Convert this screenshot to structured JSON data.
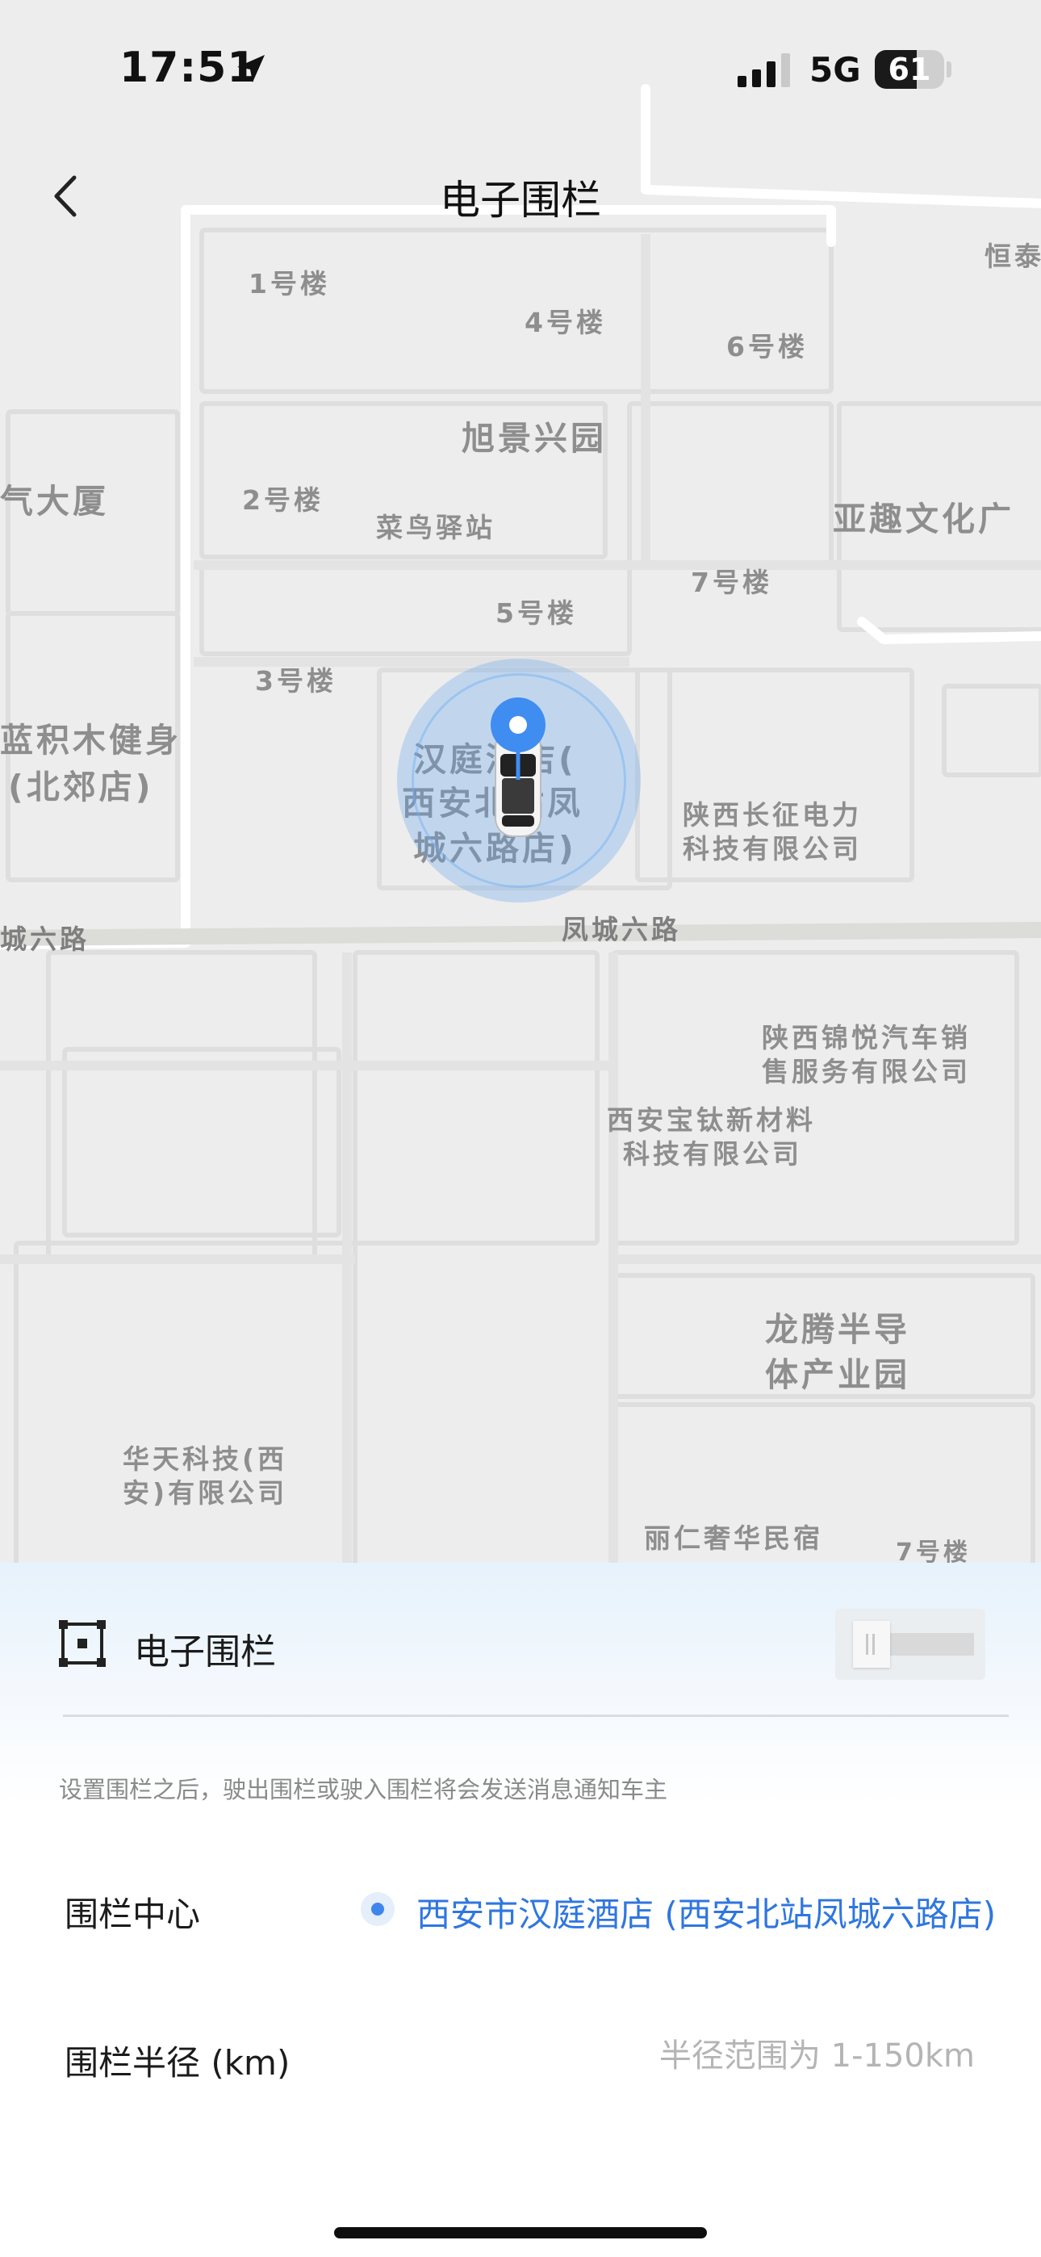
{
  "status_bar": {
    "time": "17:51",
    "network": "5G",
    "battery_level": "61",
    "battery_fraction": 0.61,
    "location_icon": "location-arrow-icon",
    "signal_icon": "cellular-signal-icon"
  },
  "nav": {
    "title": "电子围栏",
    "back_icon": "chevron-left-icon"
  },
  "map": {
    "labels": [
      {
        "id": "building-1",
        "text": "1号楼"
      },
      {
        "id": "building-4",
        "text": "4号楼"
      },
      {
        "id": "building-6",
        "text": "6号楼"
      },
      {
        "id": "hengtai",
        "text": "恒泰"
      },
      {
        "id": "xujing",
        "text": "旭景兴园"
      },
      {
        "id": "qidasha",
        "text": "气大厦"
      },
      {
        "id": "building-2",
        "text": "2号楼"
      },
      {
        "id": "cainiao",
        "text": "菜鸟驿站"
      },
      {
        "id": "yaqu",
        "text": "亚趣文化广"
      },
      {
        "id": "building-7",
        "text": "7号楼"
      },
      {
        "id": "building-5",
        "text": "5号楼"
      },
      {
        "id": "building-3",
        "text": "3号楼"
      },
      {
        "id": "lanjimu-1",
        "text": "蓝积木健身"
      },
      {
        "id": "lanjimu-2",
        "text": "(北郊店)"
      },
      {
        "id": "hanting-1",
        "text": "汉庭酒店("
      },
      {
        "id": "hanting-2",
        "text": "西安北站凤"
      },
      {
        "id": "hanting-3",
        "text": "城六路店)"
      },
      {
        "id": "changzheng-1",
        "text": "陕西长征电力"
      },
      {
        "id": "changzheng-2",
        "text": "科技有限公司"
      },
      {
        "id": "road-left",
        "text": "城六路"
      },
      {
        "id": "road-center",
        "text": "凤城六路"
      },
      {
        "id": "jinyue-1",
        "text": "陕西锦悦汽车销"
      },
      {
        "id": "jinyue-2",
        "text": "售服务有限公司"
      },
      {
        "id": "baotai-1",
        "text": "西安宝钛新材料"
      },
      {
        "id": "baotai-2",
        "text": "科技有限公司"
      },
      {
        "id": "longteng-1",
        "text": "龙腾半导"
      },
      {
        "id": "longteng-2",
        "text": "体产业园"
      },
      {
        "id": "huatian-1",
        "text": "华天科技(西"
      },
      {
        "id": "huatian-2",
        "text": "安)有限公司"
      },
      {
        "id": "liren",
        "text": "丽仁奢华民宿"
      },
      {
        "id": "building-7b",
        "text": "7号楼"
      }
    ],
    "pin_icon": "location-pin-icon",
    "car_icon": "car-icon",
    "fence_color": "#5ca2ee"
  },
  "fence": {
    "icon": "fence-frame-icon",
    "label": "电子围栏",
    "toggle_on": false,
    "notice": "设置围栏之后，驶出围栏或驶入围栏将会发送消息通知车主",
    "center_label": "围栏中心",
    "center_value": "西安市汉庭酒店 (西安北站凤城六路店)",
    "radius_label": "围栏半径 (km)",
    "radius_value": "",
    "radius_placeholder": "半径范围为 1-150km",
    "accent_color": "#2f76e0"
  }
}
